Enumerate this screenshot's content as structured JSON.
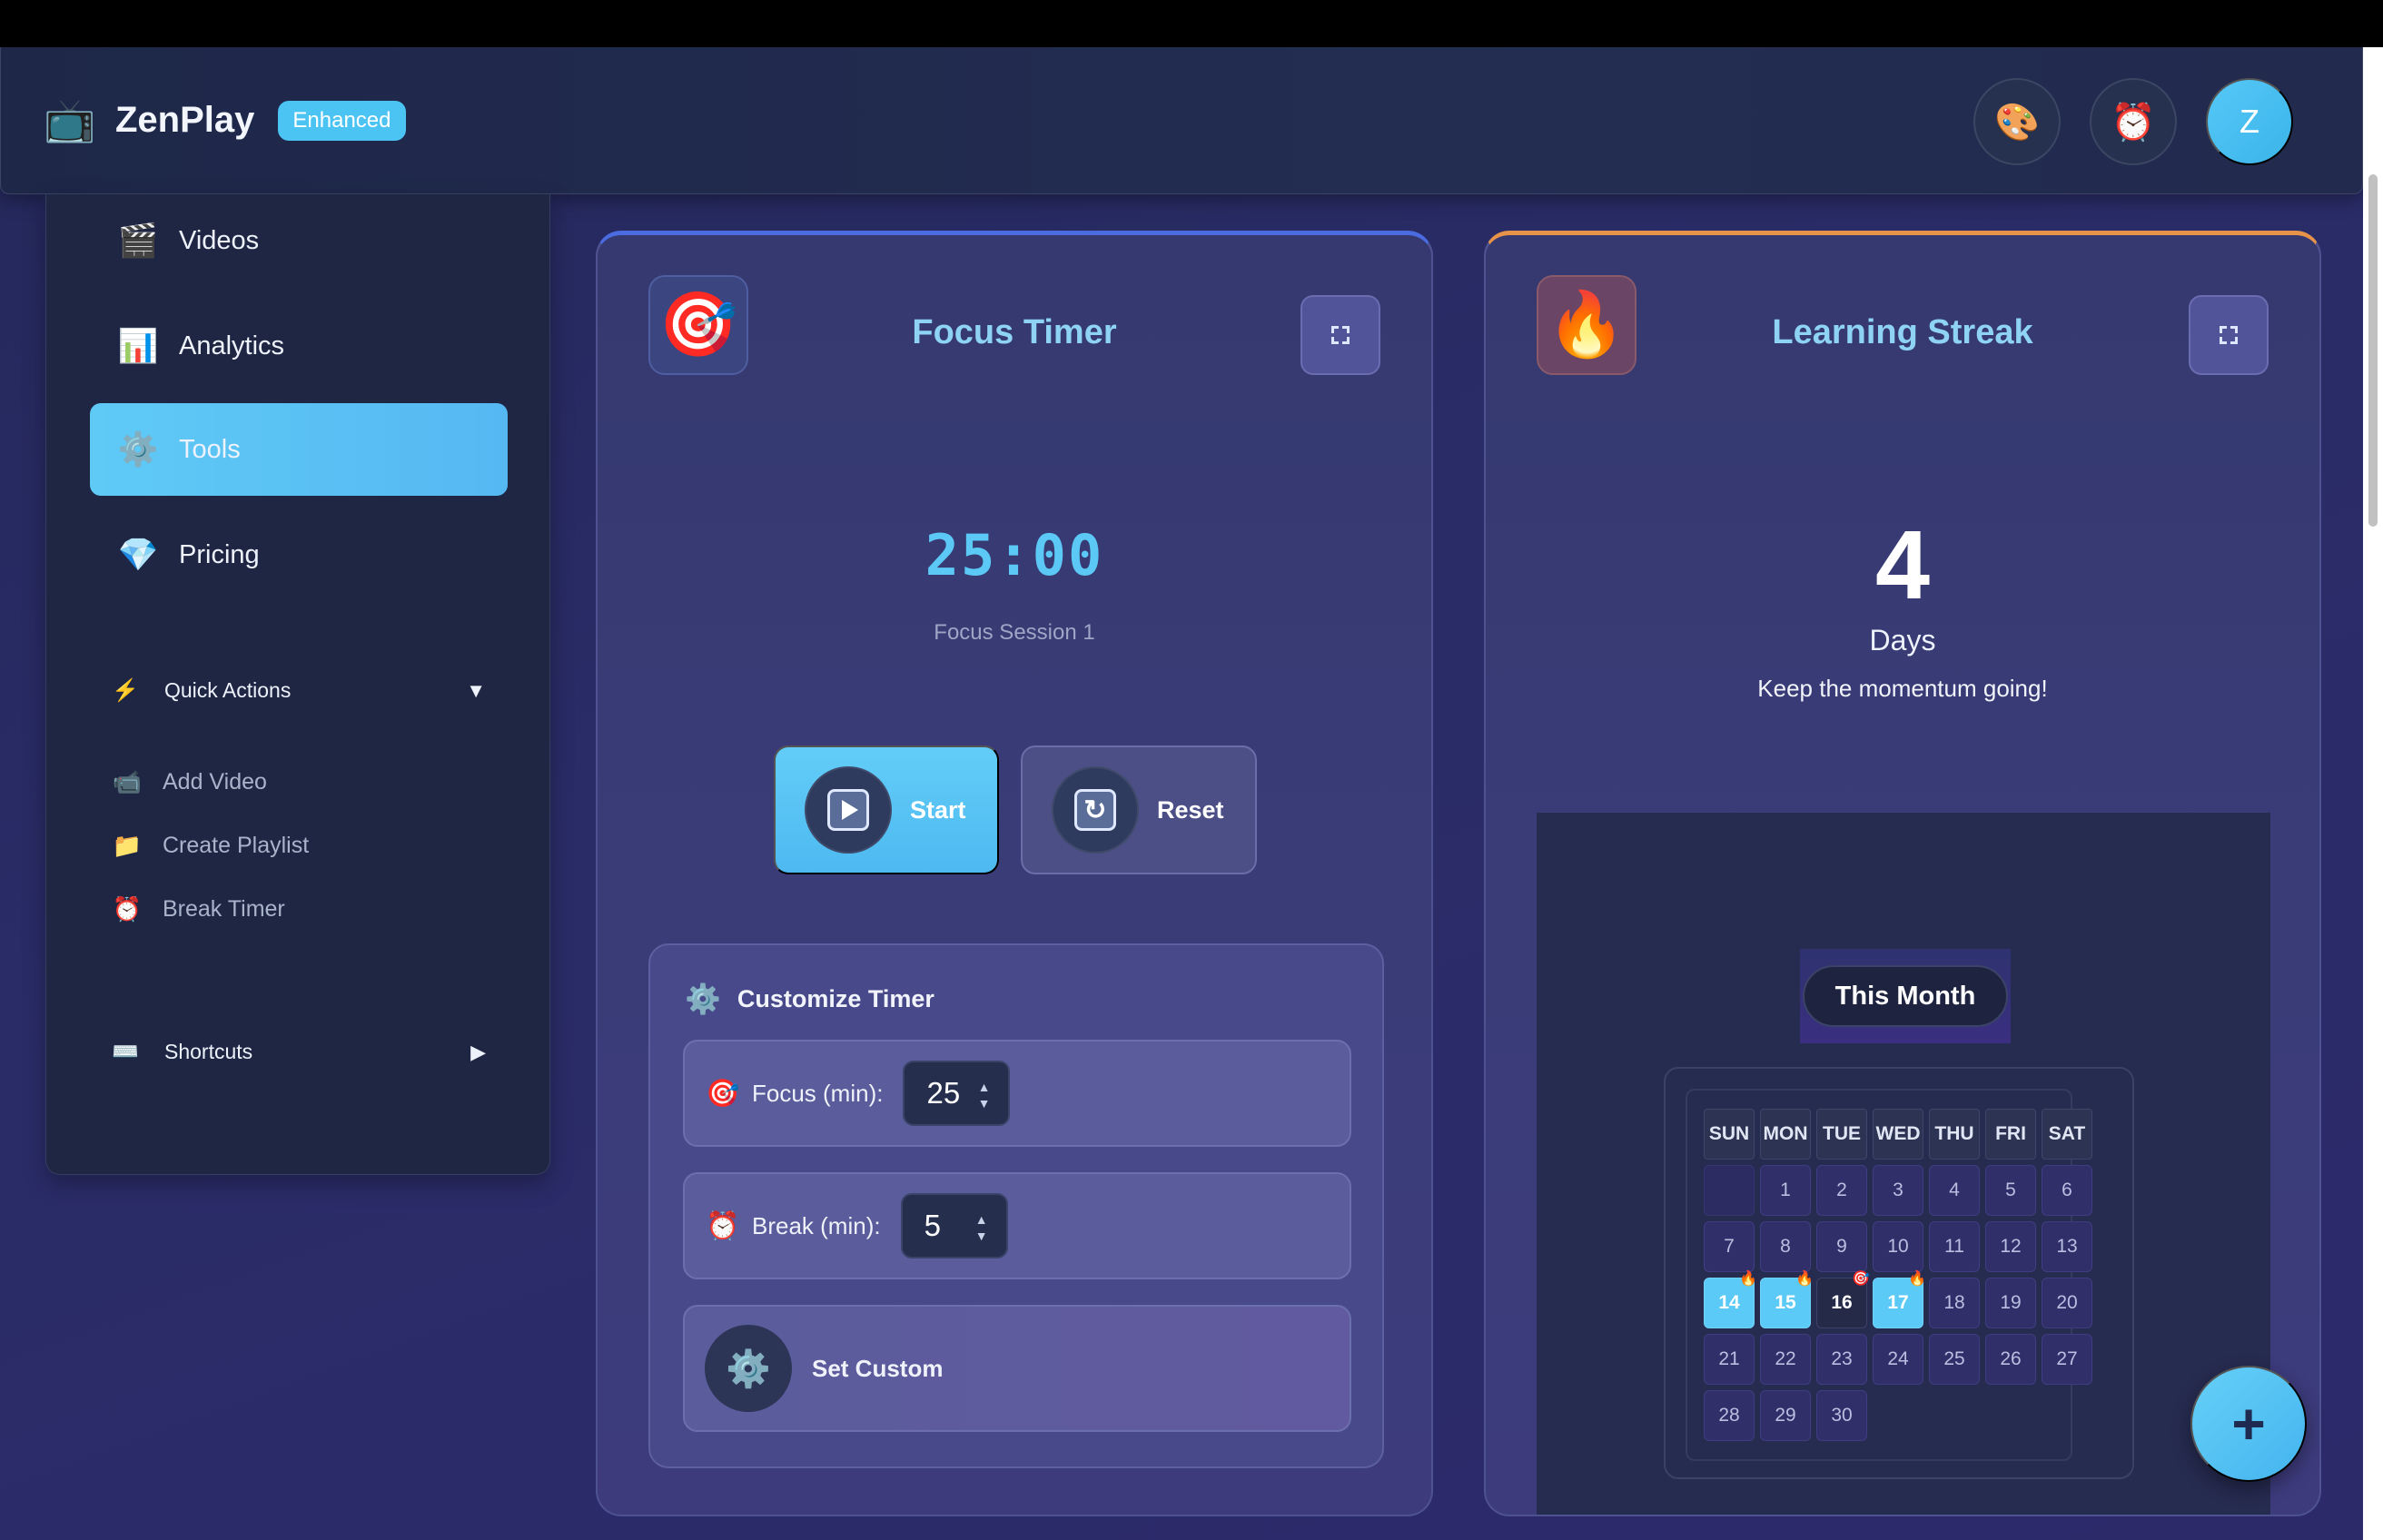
{
  "header": {
    "logo_icon": "📺",
    "brand": "ZenPlay",
    "badge": "Enhanced",
    "actions": [
      {
        "name": "palette-icon",
        "glyph": "🎨"
      },
      {
        "name": "alarm-clock-icon",
        "glyph": "⏰"
      }
    ],
    "avatar_initial": "Z"
  },
  "sidebar": {
    "nav": [
      {
        "label": "Videos",
        "icon": "🎬"
      },
      {
        "label": "Analytics",
        "icon": "📊"
      },
      {
        "label": "Tools",
        "icon": "⚙️",
        "active": true
      },
      {
        "label": "Pricing",
        "icon": "💎"
      }
    ],
    "quick_actions": {
      "title": "Quick Actions",
      "icon": "⚡",
      "caret": "▼",
      "items": [
        {
          "label": "Add Video",
          "icon": "📹"
        },
        {
          "label": "Create Playlist",
          "icon": "📁"
        },
        {
          "label": "Break Timer",
          "icon": "⏰"
        }
      ]
    },
    "shortcuts": {
      "title": "Shortcuts",
      "icon": "⌨️",
      "caret": "▶"
    }
  },
  "focus_timer": {
    "icon": "🎯",
    "title": "Focus Timer",
    "time": "25:00",
    "session": "Focus Session 1",
    "start_label": "Start",
    "reset_label": "Reset",
    "customize": {
      "title": "Customize Timer",
      "icon": "⚙️",
      "focus_label": "Focus (min):",
      "focus_icon": "🎯",
      "focus_value": "25",
      "break_label": "Break (min):",
      "break_icon": "⏰",
      "break_value": "5",
      "custom_label": "Set Custom",
      "custom_icon": "⚙️"
    }
  },
  "learning_streak": {
    "icon": "🔥",
    "title": "Learning Streak",
    "count": "4",
    "unit": "Days",
    "message": "Keep the momentum going!",
    "calendar": {
      "month_label": "This Month",
      "weekdays": [
        "SUN",
        "MON",
        "TUE",
        "WED",
        "THU",
        "FRI",
        "SAT"
      ],
      "leading_blanks": 1,
      "days_in_month": 30,
      "streak_days": [
        14,
        15,
        17
      ],
      "today": 16,
      "streak_mark": "🔥",
      "today_mark": "🎯"
    }
  },
  "fab_label": "+",
  "colors": {
    "accent": "#5cc8f5",
    "streak_accent": "#e8934a",
    "focus_accent": "#4b6be0"
  }
}
